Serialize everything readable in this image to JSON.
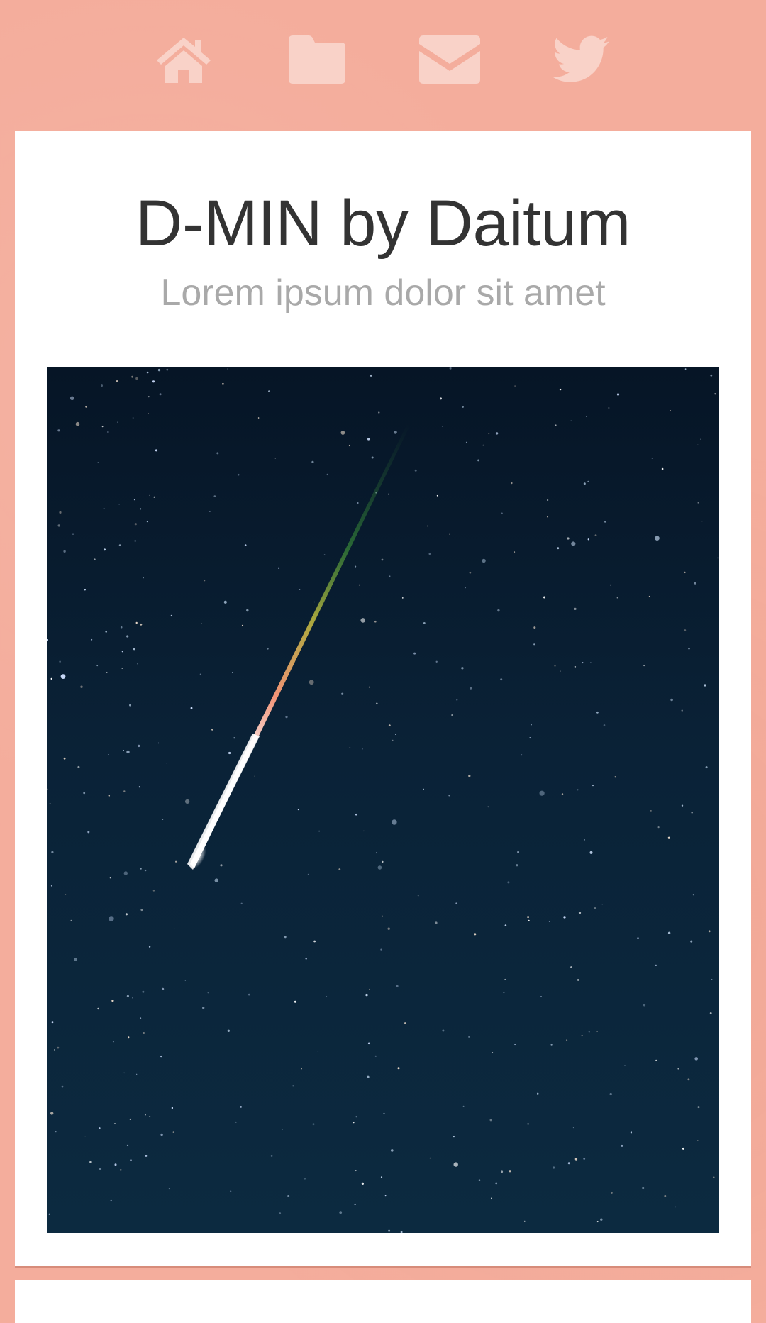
{
  "nav": {
    "items": [
      {
        "icon": "home-icon"
      },
      {
        "icon": "folder-icon"
      },
      {
        "icon": "envelope-icon"
      },
      {
        "icon": "twitter-icon"
      }
    ],
    "icon_color": "#f9d2c8"
  },
  "post": {
    "title": "D-MIN by Daitum",
    "subtitle": "Lorem ipsum dolor sit amet",
    "image": "night-sky-meteor"
  },
  "colors": {
    "background": "#f4ad9c",
    "card": "#ffffff",
    "title": "#333333",
    "subtitle": "#a9a9a9"
  }
}
